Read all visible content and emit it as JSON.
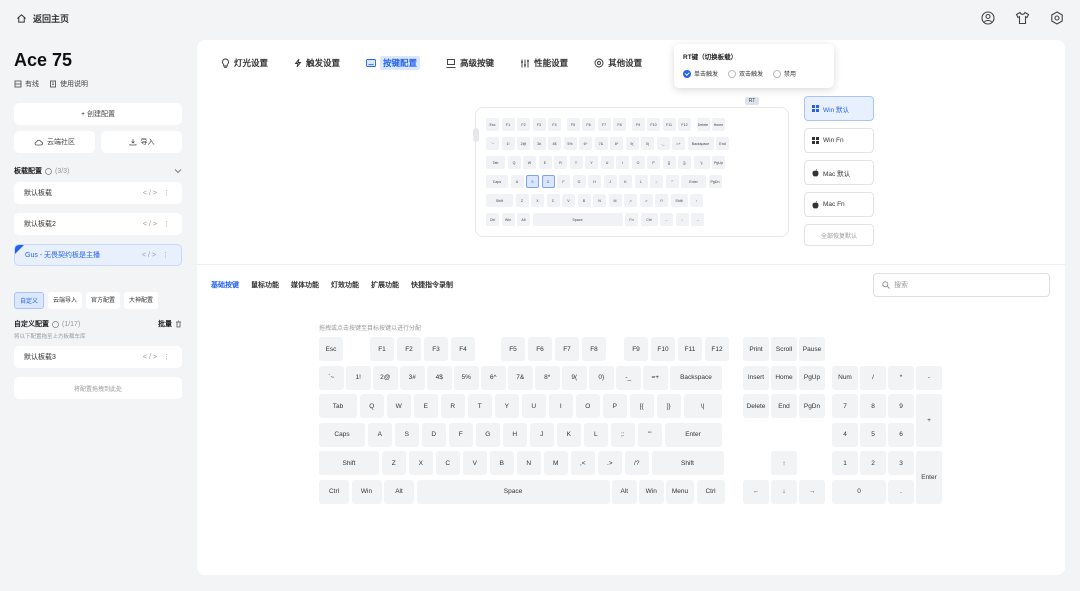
{
  "topbar": {
    "home_label": "返回主页",
    "icons": [
      "user-icon",
      "shirt-icon",
      "settings-icon"
    ]
  },
  "device": {
    "name": "Ace 75",
    "connection": "有线",
    "manual": "使用说明"
  },
  "sidebar": {
    "create_label": "+ 创建配置",
    "cloud_label": "云端社区",
    "import_label": "导入",
    "boards_title": "板载配置",
    "boards_count": "(3/3)",
    "boards": [
      {
        "name": "默认板载"
      },
      {
        "name": "默认板载2"
      },
      {
        "name": "Gus - 无畏契约板是主播"
      }
    ],
    "filter_tabs": [
      "自定义",
      "云端导入",
      "官方配置",
      "大神配置"
    ],
    "custom_title": "自定义配置",
    "custom_count": "(1/17)",
    "custom_batch": "批量",
    "custom_subtitle": "将以下配置拖至上方板载车库",
    "custom_items": [
      {
        "name": "默认板载3"
      }
    ],
    "drop_label": "将配置拖拽到此处"
  },
  "main_tabs": [
    "灯光设置",
    "触发设置",
    "按键配置",
    "高级按键",
    "性能设置",
    "其他设置"
  ],
  "rt_popup": {
    "title": "RT键（切换板载）",
    "options": [
      "单击触发",
      "双击触发",
      "禁用"
    ],
    "badge": "RT"
  },
  "layout_presets": [
    "Win 默认",
    "Win Fn",
    "Mac 默认",
    "Mac Fn"
  ],
  "reset_label": "全部恢复默认",
  "func_tabs": [
    "基础按键",
    "鼠标功能",
    "媒体功能",
    "灯效功能",
    "扩展功能",
    "快捷指令录制"
  ],
  "search_placeholder": "搜索",
  "hint_text": "拖拽或点击按键至目标按键以进行分配",
  "mini_rows": [
    [
      "Esc",
      "F1",
      "F2",
      "F3",
      "F4",
      "F5",
      "F6",
      "F7",
      "F8",
      "F9",
      "F10",
      "F11",
      "F12",
      "Delete",
      "Home"
    ],
    [
      "`~",
      "1!",
      "2@",
      "3#",
      "4$",
      "5%",
      "6^",
      "7&",
      "8*",
      "9(",
      "0)",
      "-_",
      "=+",
      "Backspace",
      "End"
    ],
    [
      "Tab",
      "Q",
      "W",
      "E",
      "R",
      "T",
      "Y",
      "U",
      "I",
      "O",
      "P",
      "[{",
      "]}",
      "\\|",
      "PgUp"
    ],
    [
      "Caps",
      "A",
      "S",
      "D",
      "F",
      "G",
      "H",
      "J",
      "K",
      "L",
      ";:",
      "'\"",
      "Enter",
      "PgDn"
    ],
    [
      "Shift",
      "Z",
      "X",
      "C",
      "V",
      "B",
      "N",
      "M",
      ",<",
      ".>",
      "/?",
      "Shift",
      "↑"
    ],
    [
      "Ctrl",
      "Win",
      "Alt",
      "Space",
      "Fn",
      "Ctrl",
      "←",
      "↓",
      "→"
    ]
  ],
  "big_keys": {
    "esc": "Esc",
    "f": [
      "F1",
      "F2",
      "F3",
      "F4",
      "F5",
      "F6",
      "F7",
      "F8",
      "F9",
      "F10",
      "F11",
      "F12"
    ],
    "nav_top": [
      "Print",
      "Scroll",
      "Pause"
    ],
    "num_row": [
      "`~",
      "1!",
      "2@",
      "3#",
      "4$",
      "5%",
      "6^",
      "7&",
      "8*",
      "9(",
      "0)",
      "-_",
      "=+",
      "Backspace"
    ],
    "nav_mid1": [
      "Insert",
      "Home",
      "PgUp"
    ],
    "numpad1": [
      "Num",
      "/",
      "*",
      "-"
    ],
    "tab_row": [
      "Tab",
      "Q",
      "W",
      "E",
      "R",
      "T",
      "Y",
      "U",
      "I",
      "O",
      "P",
      "[{",
      "]}",
      "\\|"
    ],
    "nav_mid2": [
      "Delete",
      "End",
      "PgDn"
    ],
    "numpad2": [
      "7",
      "8",
      "9",
      "+"
    ],
    "caps_row": [
      "Caps",
      "A",
      "S",
      "D",
      "F",
      "G",
      "H",
      "J",
      "K",
      "L",
      ";:",
      "'\"",
      "Enter"
    ],
    "numpad3": [
      "4",
      "5",
      "6"
    ],
    "shift_row": [
      "Shift",
      "Z",
      "X",
      "C",
      "V",
      "B",
      "N",
      "M",
      ",<",
      ".>",
      "/?",
      "Shift"
    ],
    "up": "↑",
    "numpad4": [
      "1",
      "2",
      "3",
      "Enter"
    ],
    "ctrl_row": [
      "Ctrl",
      "Win",
      "Alt",
      "Space",
      "Alt",
      "Win",
      "Menu",
      "Ctrl"
    ],
    "arrows": [
      "←",
      "↓",
      "→"
    ],
    "numpad5": [
      "0",
      "."
    ]
  },
  "colors": {
    "accent": "#2563eb",
    "panel": "#ffffff",
    "bg": "#f3f4f6",
    "key": "#f1f3f5"
  }
}
